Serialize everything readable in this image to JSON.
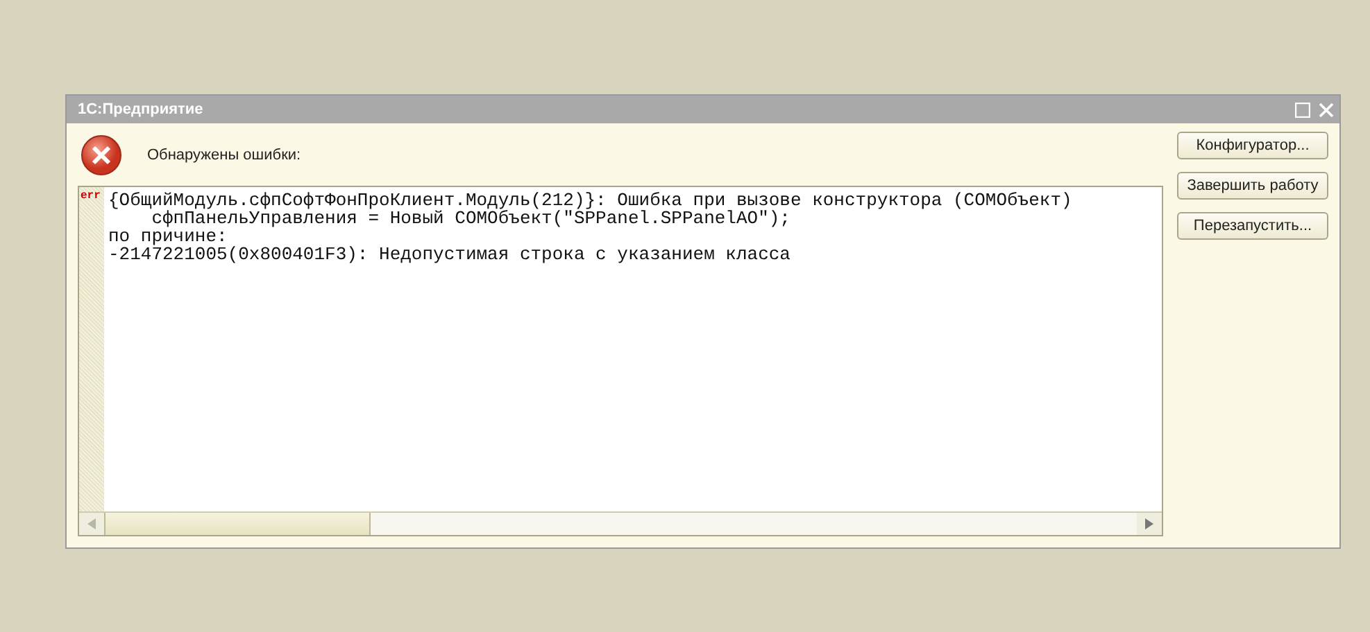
{
  "window": {
    "title": "1С:Предприятие"
  },
  "message": "Обнаружены ошибки:",
  "error_log": {
    "marker": "err",
    "lines": [
      "{ОбщийМодуль.сфпСофтФонПроКлиент.Модуль(212)}: Ошибка при вызове конструктора (COMОбъект)",
      "    сфпПанельУправления = Новый COMОбъект(\"SPPanel.SPPanelAO\");",
      "по причине:",
      "-2147221005(0x800401F3): Недопустимая строка с указанием класса"
    ]
  },
  "buttons": [
    "Конфигуратор...",
    "Завершить работу",
    "Перезапустить..."
  ]
}
